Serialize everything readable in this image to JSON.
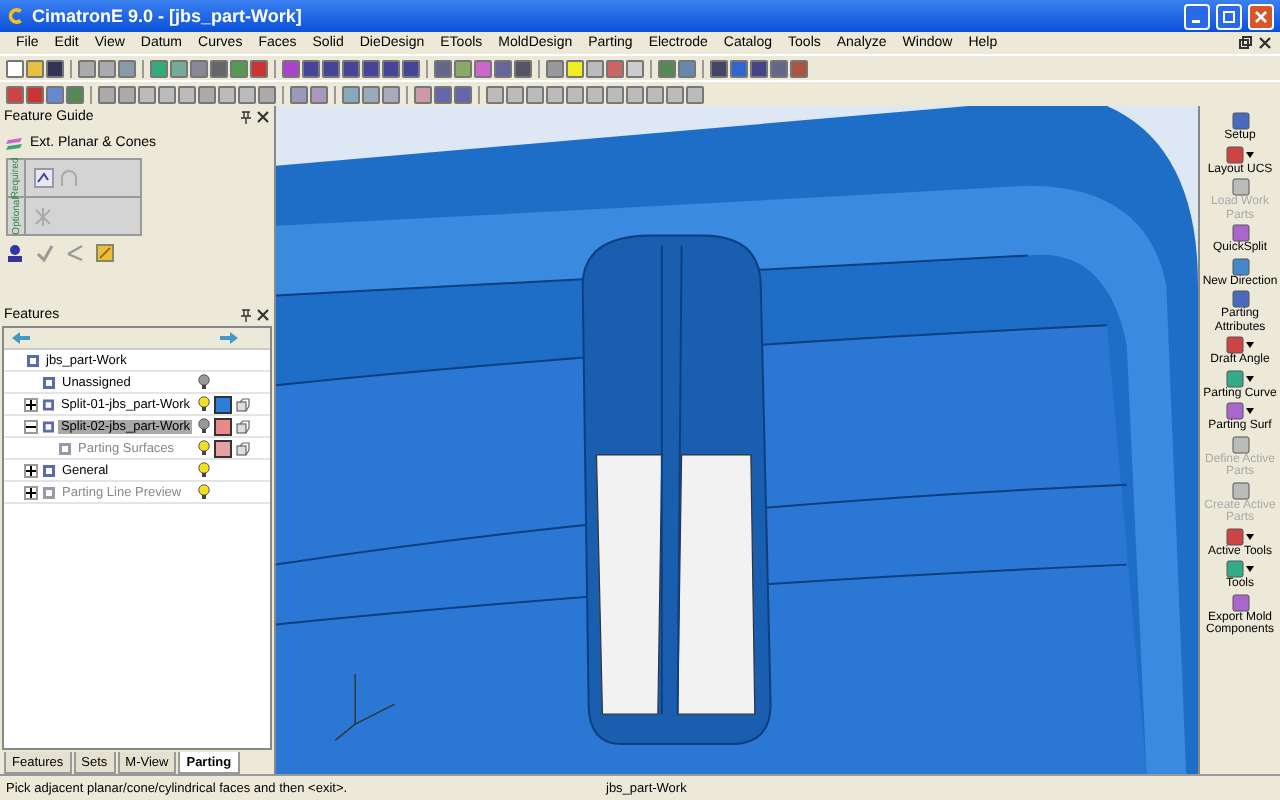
{
  "window": {
    "title": "CimatronE 9.0 - [jbs_part-Work]"
  },
  "menu": [
    "File",
    "Edit",
    "View",
    "Datum",
    "Curves",
    "Faces",
    "Solid",
    "DieDesign",
    "ETools",
    "MoldDesign",
    "Parting",
    "Electrode",
    "Catalog",
    "Tools",
    "Analyze",
    "Window",
    "Help"
  ],
  "feature_guide": {
    "title": "Feature Guide",
    "step": "Ext. Planar & Cones",
    "sections": [
      "Required",
      "Optional"
    ]
  },
  "features": {
    "title": "Features",
    "tree": [
      {
        "label": "jbs_part-Work",
        "selected": false,
        "dimmed": false,
        "children": [
          {
            "label": "Unassigned",
            "selected": false,
            "dimmed": false,
            "visible": false
          },
          {
            "label": "Split-01-jbs_part-Work",
            "expanded": false,
            "selected": false,
            "dimmed": false,
            "visible": true,
            "color": "#2a7fd8"
          },
          {
            "label": "Split-02-jbs_part-Work",
            "expanded": true,
            "selected": true,
            "dimmed": false,
            "visible": false,
            "color": "#e88a8a",
            "children": [
              {
                "label": "Parting Surfaces",
                "selected": false,
                "dimmed": true,
                "visible": true,
                "color": "#e8a0a0"
              }
            ]
          },
          {
            "label": "General",
            "expanded": false,
            "selected": false,
            "dimmed": false,
            "visible": true
          },
          {
            "label": "Parting Line Preview",
            "expanded": false,
            "selected": false,
            "dimmed": true,
            "visible": true
          }
        ]
      }
    ]
  },
  "panel_tabs": [
    {
      "label": "Features",
      "selected": false
    },
    {
      "label": "Sets",
      "selected": false
    },
    {
      "label": "M-View",
      "selected": false
    },
    {
      "label": "Parting",
      "selected": true
    }
  ],
  "mold_toolbar": [
    {
      "label": "Setup",
      "dropdown": false,
      "disabled": false
    },
    {
      "label": "Layout UCS",
      "dropdown": true,
      "disabled": false
    },
    {
      "label": "Load Work Parts",
      "dropdown": false,
      "disabled": true
    },
    {
      "label": "QuickSplit",
      "dropdown": false,
      "disabled": false
    },
    {
      "label": "New Direction",
      "dropdown": false,
      "disabled": false
    },
    {
      "label": "Parting Attributes",
      "dropdown": false,
      "disabled": false
    },
    {
      "label": "Draft Angle",
      "dropdown": true,
      "disabled": false
    },
    {
      "label": "Parting Curve",
      "dropdown": true,
      "disabled": false
    },
    {
      "label": "Parting Surf",
      "dropdown": true,
      "disabled": false
    },
    {
      "label": "Define Active Parts",
      "dropdown": false,
      "disabled": true
    },
    {
      "label": "Create Active Parts",
      "dropdown": false,
      "disabled": true
    },
    {
      "label": "Active Tools",
      "dropdown": true,
      "disabled": false
    },
    {
      "label": "Tools",
      "dropdown": true,
      "disabled": false
    },
    {
      "label": "Export Mold Components",
      "dropdown": false,
      "disabled": false
    }
  ],
  "status_bar": {
    "prompt": "Pick adjacent planar/cone/cylindrical faces and then <exit>.",
    "document": "jbs_part-Work"
  }
}
